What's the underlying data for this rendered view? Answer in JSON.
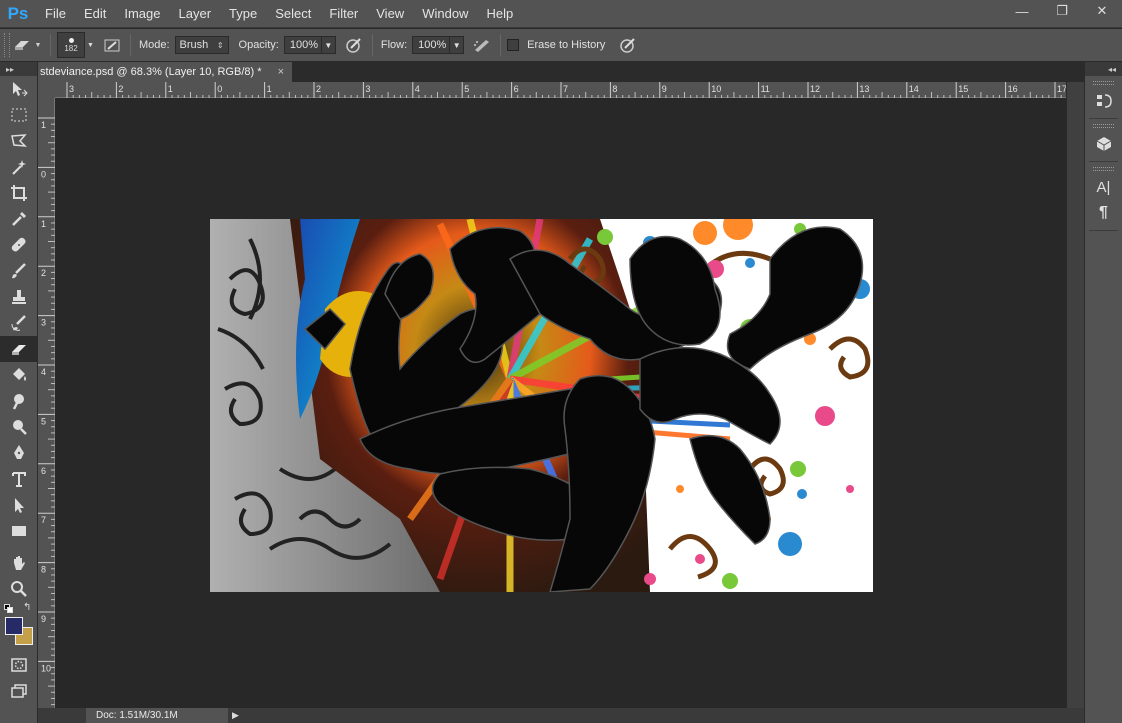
{
  "app": {
    "logo": "Ps",
    "accent": "#31a8ff"
  },
  "menu": [
    "File",
    "Edit",
    "Image",
    "Layer",
    "Type",
    "Select",
    "Filter",
    "View",
    "Window",
    "Help"
  ],
  "window_controls": [
    "—",
    "❐",
    "✕"
  ],
  "options": {
    "brush_size": "182",
    "mode_label": "Mode:",
    "mode_value": "Brush",
    "opacity_label": "Opacity:",
    "opacity_value": "100%",
    "flow_label": "Flow:",
    "flow_value": "100%",
    "erase_history_label": "Erase to History"
  },
  "toolbar": {
    "collapse": "▸▸"
  },
  "document": {
    "tab_title": "stdeviance.psd @ 68.3% (Layer 10, RGB/8) *",
    "close": "×"
  },
  "ruler": {
    "top_labels": [
      "3",
      "2",
      "1",
      "0",
      "1",
      "2",
      "3",
      "4",
      "5",
      "6",
      "7",
      "8",
      "9",
      "10",
      "11",
      "12",
      "13",
      "14",
      "15",
      "16",
      "17"
    ],
    "left_labels": [
      "1",
      "0",
      "1",
      "2",
      "3",
      "4",
      "5",
      "6",
      "7",
      "8",
      "9",
      "10"
    ]
  },
  "status": {
    "doc_info": "Doc: 1.51M/30.1M",
    "arrow": "▶"
  },
  "rightpanel": {
    "collapse": "◂◂",
    "char_icon": "A|",
    "para_icon": "¶"
  },
  "colors": {
    "foreground": "#262a66",
    "background": "#c4a04a"
  }
}
